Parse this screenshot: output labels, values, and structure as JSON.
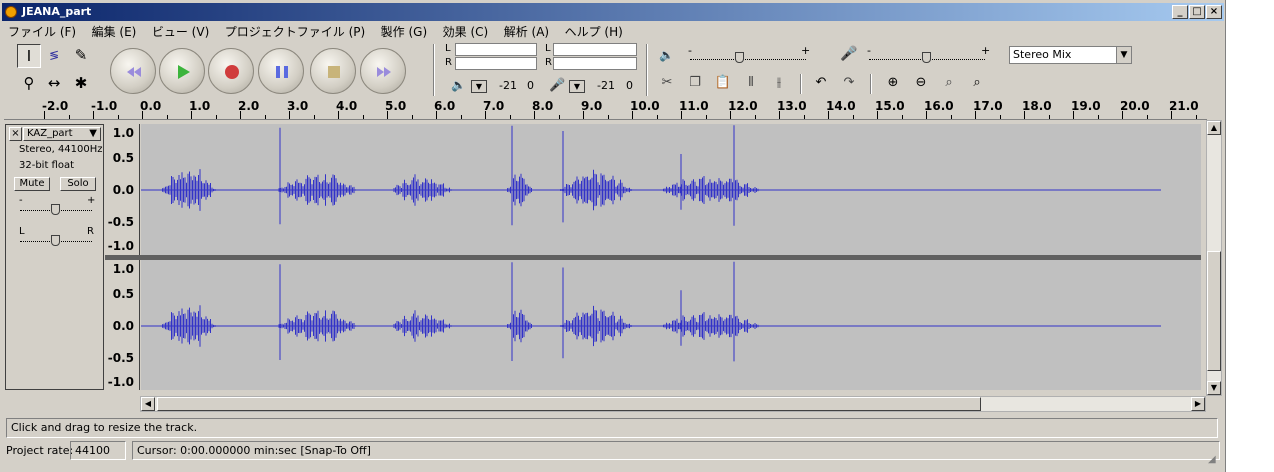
{
  "window": {
    "title": "JEANA_part"
  },
  "menu": [
    "ファイル (F)",
    "編集 (E)",
    "ビュー (V)",
    "プロジェクトファイル (P)",
    "製作 (G)",
    "効果 (C)",
    "解析 (A)",
    "ヘルプ (H)"
  ],
  "meters": {
    "play_L": "L",
    "play_R": "R",
    "play_db": "-21",
    "play_zero": "0",
    "rec_L": "L",
    "rec_R": "R",
    "rec_db": "-21",
    "rec_zero": "0"
  },
  "mixer": {
    "minus": "-",
    "plus": "+",
    "rec_minus": "-",
    "rec_plus": "+"
  },
  "input_source": {
    "value": "Stereo Mix"
  },
  "ruler": {
    "ticks": [
      "-2.0",
      "-1.0",
      "0.0",
      "1.0",
      "2.0",
      "3.0",
      "4.0",
      "5.0",
      "6.0",
      "7.0",
      "8.0",
      "9.0",
      "10.0",
      "11.0",
      "12.0",
      "13.0",
      "14.0",
      "15.0",
      "16.0",
      "17.0",
      "18.0",
      "19.0",
      "20.0",
      "21.0"
    ]
  },
  "track": {
    "name": "KAZ_part",
    "format": "Stereo, 44100Hz",
    "bits": "32-bit float",
    "mute": "Mute",
    "solo": "Solo",
    "gain_minus": "-",
    "gain_plus": "+",
    "pan_left": "L",
    "pan_right": "R",
    "scale_top": [
      "1.0",
      "0.5",
      "0.0",
      "-0.5",
      "-1.0"
    ],
    "scale_bottom": [
      "1.0",
      "0.5",
      "0.0",
      "-0.5",
      "-1.0"
    ]
  },
  "status": {
    "message": "Click and drag to resize the track."
  },
  "bottom": {
    "rate_label": "Project rate:",
    "rate_value": "44100",
    "cursor": "Cursor: 0:00.000000 min:sec   [Snap-To Off]"
  },
  "colors": {
    "waveform": "#3232c8",
    "wave_bg": "#c0c0c0",
    "chrome": "#d4d0c8"
  }
}
